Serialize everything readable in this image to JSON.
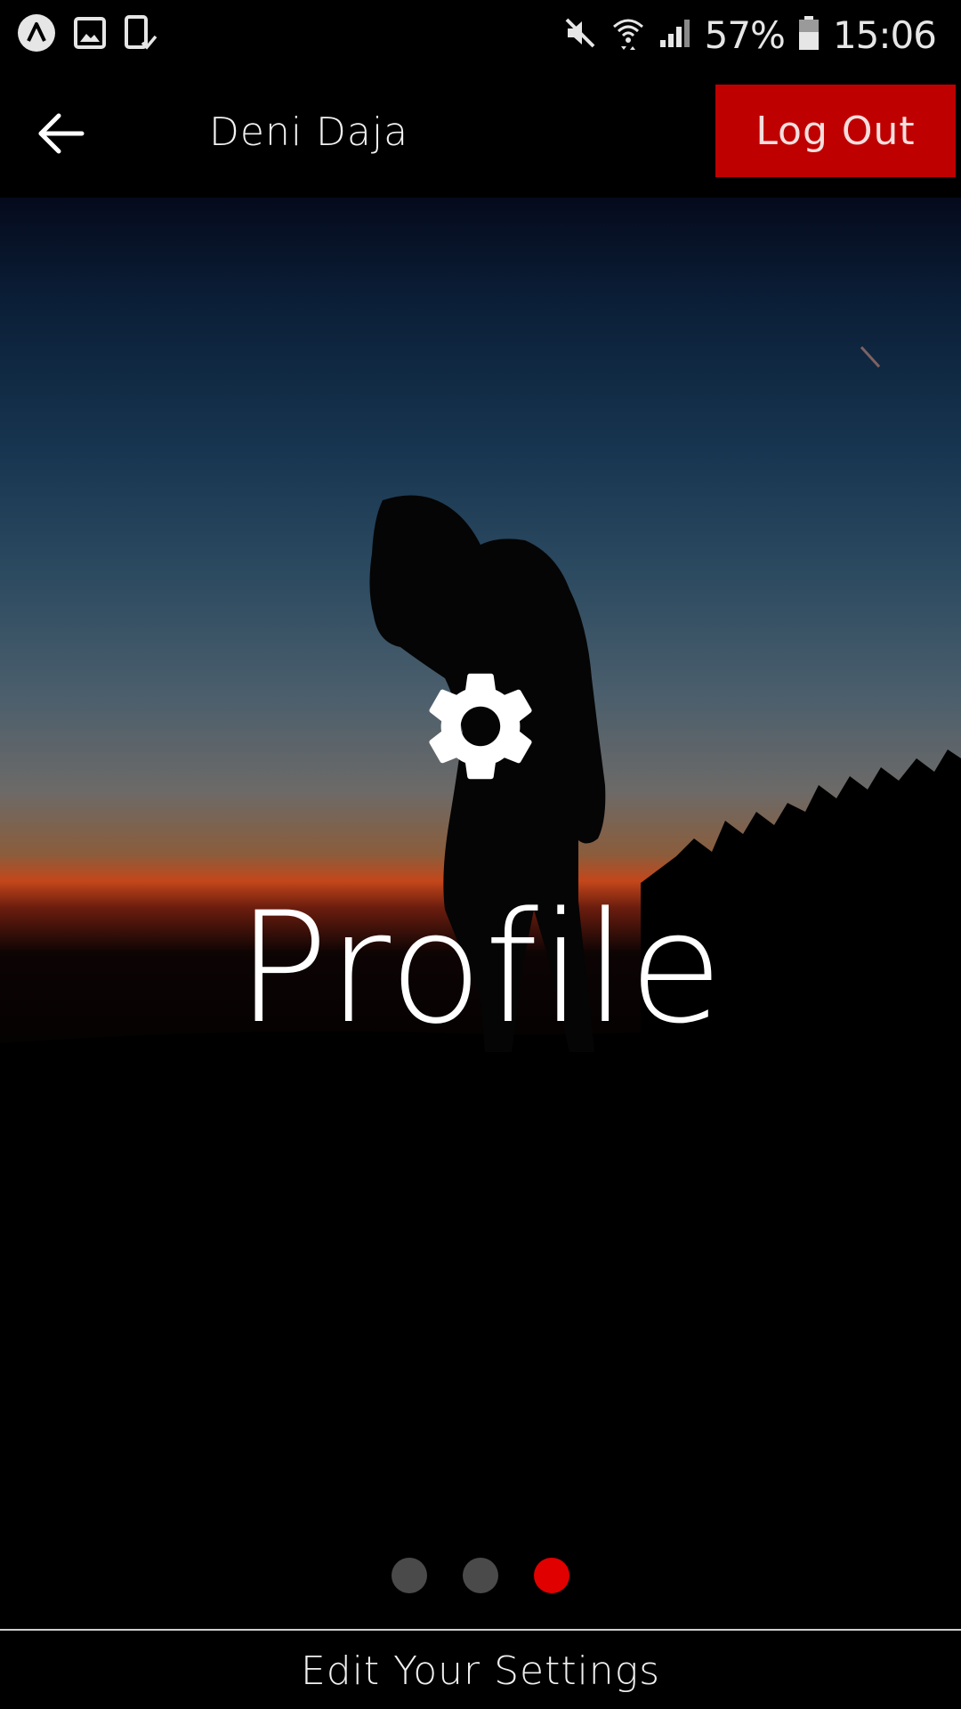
{
  "status_bar": {
    "battery_percent": "57%",
    "time": "15:06",
    "icons": [
      "app-notification-icon",
      "gallery-icon",
      "device-check-icon",
      "mute-icon",
      "wifi-icon",
      "signal-icon",
      "battery-icon"
    ]
  },
  "header": {
    "title": "Deni Daja",
    "logout_label": "Log Out",
    "logout_color": "#bf0000"
  },
  "hero": {
    "icon": "gear-icon",
    "title": "Profile"
  },
  "pager": {
    "pages": 3,
    "active_index": 2,
    "active_color": "#e00000",
    "inactive_color": "#4a4a4a"
  },
  "footer": {
    "link_label": "Edit Your Settings"
  }
}
